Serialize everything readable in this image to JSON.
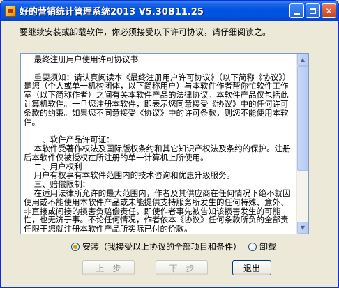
{
  "window": {
    "title": "好的营销统计管理系统2013 V5.30B11.25"
  },
  "instruction": "要继续安装或卸载软件，你必须接受以下许可协议，请仔细阅读之。",
  "license": {
    "text": "    最终注册用户使用许可协议书\n\n    重要须知：请认真阅读本《最终注册用户许可协议》（以下简称《协议》）是您（个人或单一机构团体，以下简称用户）与本软件作者帮你忙软件工作室（以下简称作者）之间有关本软件产品的法律协议。本软件产品仅包括此计算机软件。一旦您注册本软件，即表示您同意接受《协议》中的任何许可条款的约束。如果您不同意接受《协议》中的许可条款，则您不能使用本软件。\n\n    一、软件产品许可证：\n    本软件受著作权法及国际版权条约和其它知识产权法及条约的保护。注册后本软件仅被授权在所注册的单一计算机上所使用。\n    二、用户权利：\n    用户有权享有本软件范围内的技术咨询和优惠升级服务。\n    三、赔偿限制：\n    在适用法律所允许的最大范围内，作者及其供应商在任何情况下绝不就因使用或不能使用本软件产品或未能提供支持服务所发生的任何特殊、意外、非直接或间接的损害负赔偿责任，即使作者事先被告知该损害发生的可能性，也无济于事。不论任何情况，作者依本《协议》任何条款所负的全部责任限于您就注册本软件产品所实际已付的价款。"
  },
  "options": {
    "install_label": "安装（我接受以上协议的全部项目和条件）",
    "uninstall_label": "卸载"
  },
  "buttons": {
    "prev": "上一步",
    "next": "下一步",
    "exit": "退出"
  },
  "titlebar_buttons": {
    "close": "✕"
  }
}
